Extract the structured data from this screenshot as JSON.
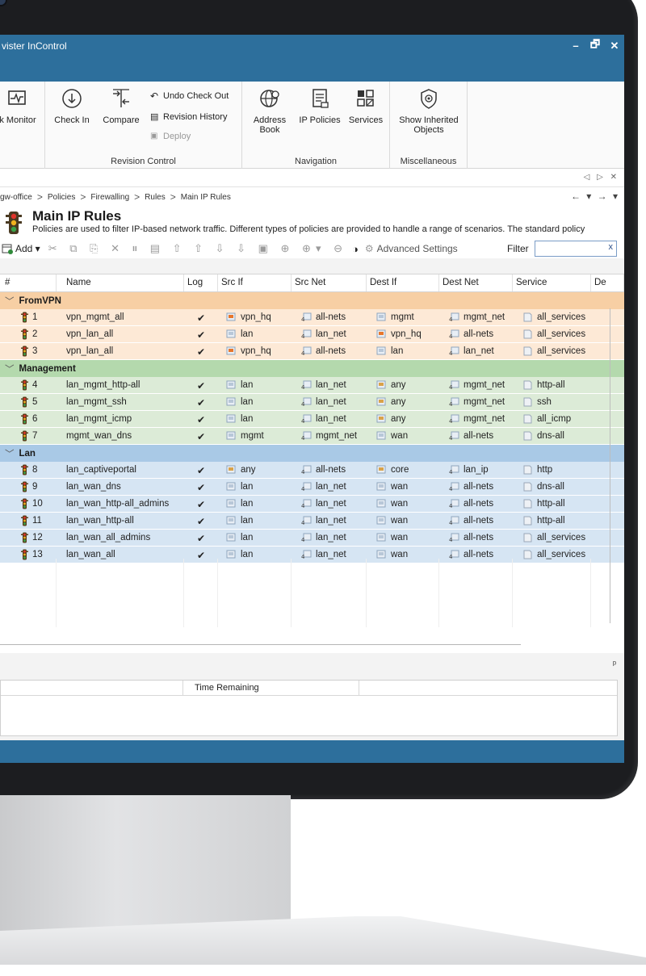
{
  "window": {
    "title": "vister InControl",
    "controls": [
      "–",
      "🗗",
      "✕"
    ]
  },
  "ribbon": {
    "monitor_label": "k Monitor",
    "revision_control": {
      "label": "Revision Control",
      "check_in": "Check In",
      "compare": "Compare",
      "undo_check_out": "Undo Check Out",
      "revision_history": "Revision History",
      "deploy": "Deploy"
    },
    "navigation": {
      "label": "Navigation",
      "address_book_line1": "Address",
      "address_book_line2": "Book",
      "ip_policies": "IP Policies",
      "services": "Services"
    },
    "miscellaneous": {
      "label": "Miscellaneous",
      "show_inherited_line1": "Show Inherited",
      "show_inherited_line2": "Objects"
    }
  },
  "tabstrip": {
    "controls": "◁ ▷ ✕"
  },
  "breadcrumb": {
    "items": [
      "gw-office",
      "Policies",
      "Firewalling",
      "Rules",
      "Main IP Rules"
    ],
    "nav": "← ▾ → ▾"
  },
  "page": {
    "title": "Main IP Rules",
    "description": "Policies are used to filter IP-based network traffic. Different types of policies are provided to handle a range of scenarios. The standard policy"
  },
  "toolbar": {
    "add_label": "Add ▾",
    "icons": "✂ ⧉ ⎘ ✕ ⏸ ▤ ⇧ ⇧ ⇩ ⇩ ▣ ⊕ ⊕▾ ⊖",
    "advanced_settings": "Advanced Settings",
    "filter_label": "Filter",
    "filter_value": "",
    "filter_clear": "x"
  },
  "grid": {
    "columns": [
      "#",
      "Name",
      "Log",
      "Src If",
      "Src Net",
      "Dest If",
      "Dest Net",
      "Service",
      "De"
    ],
    "groups": [
      {
        "name": "FromVPN",
        "rows": [
          {
            "num": "1",
            "name": "vpn_mgmt_all",
            "log": "✔",
            "src_if": "vpn_hq",
            "src_net": "all-nets",
            "dest_if": "mgmt",
            "dest_net": "mgmt_net",
            "service": "all_services"
          },
          {
            "num": "2",
            "name": "vpn_lan_all",
            "log": "✔",
            "src_if": "lan",
            "src_net": "lan_net",
            "dest_if": "vpn_hq",
            "dest_net": "all-nets",
            "service": "all_services"
          },
          {
            "num": "3",
            "name": "vpn_lan_all",
            "log": "✔",
            "src_if": "vpn_hq",
            "src_net": "all-nets",
            "dest_if": "lan",
            "dest_net": "lan_net",
            "service": "all_services"
          }
        ]
      },
      {
        "name": "Management",
        "rows": [
          {
            "num": "4",
            "name": "lan_mgmt_http-all",
            "log": "✔",
            "src_if": "lan",
            "src_net": "lan_net",
            "dest_if": "any",
            "dest_net": "mgmt_net",
            "service": "http-all"
          },
          {
            "num": "5",
            "name": "lan_mgmt_ssh",
            "log": "✔",
            "src_if": "lan",
            "src_net": "lan_net",
            "dest_if": "any",
            "dest_net": "mgmt_net",
            "service": "ssh"
          },
          {
            "num": "6",
            "name": "lan_mgmt_icmp",
            "log": "✔",
            "src_if": "lan",
            "src_net": "lan_net",
            "dest_if": "any",
            "dest_net": "mgmt_net",
            "service": "all_icmp"
          },
          {
            "num": "7",
            "name": "mgmt_wan_dns",
            "log": "✔",
            "src_if": "mgmt",
            "src_net": "mgmt_net",
            "dest_if": "wan",
            "dest_net": "all-nets",
            "service": "dns-all"
          }
        ]
      },
      {
        "name": "Lan",
        "rows": [
          {
            "num": "8",
            "name": "lan_captiveportal",
            "log": "✔",
            "src_if": "any",
            "src_net": "all-nets",
            "dest_if": "core",
            "dest_net": "lan_ip",
            "service": "http"
          },
          {
            "num": "9",
            "name": "lan_wan_dns",
            "log": "✔",
            "src_if": "lan",
            "src_net": "lan_net",
            "dest_if": "wan",
            "dest_net": "all-nets",
            "service": "dns-all"
          },
          {
            "num": "10",
            "name": "lan_wan_http-all_admins",
            "log": "✔",
            "src_if": "lan",
            "src_net": "lan_net",
            "dest_if": "wan",
            "dest_net": "all-nets",
            "service": "http-all"
          },
          {
            "num": "11",
            "name": "lan_wan_http-all",
            "log": "✔",
            "src_if": "lan",
            "src_net": "lan_net",
            "dest_if": "wan",
            "dest_net": "all-nets",
            "service": "http-all"
          },
          {
            "num": "12",
            "name": "lan_wan_all_admins",
            "log": "✔",
            "src_if": "lan",
            "src_net": "lan_net",
            "dest_if": "wan",
            "dest_net": "all-nets",
            "service": "all_services"
          },
          {
            "num": "13",
            "name": "lan_wan_all",
            "log": "✔",
            "src_if": "lan",
            "src_net": "lan_net",
            "dest_if": "wan",
            "dest_net": "all-nets",
            "service": "all_services"
          }
        ]
      }
    ]
  },
  "lower_panel": {
    "pin": "ᵖ",
    "time_remaining": "Time Remaining"
  },
  "colors": {
    "titlebar": "#2d6f9c",
    "group_fromvpn": "#f7cfa4",
    "group_management": "#b4d9ad",
    "group_lan": "#a9c9e6"
  }
}
